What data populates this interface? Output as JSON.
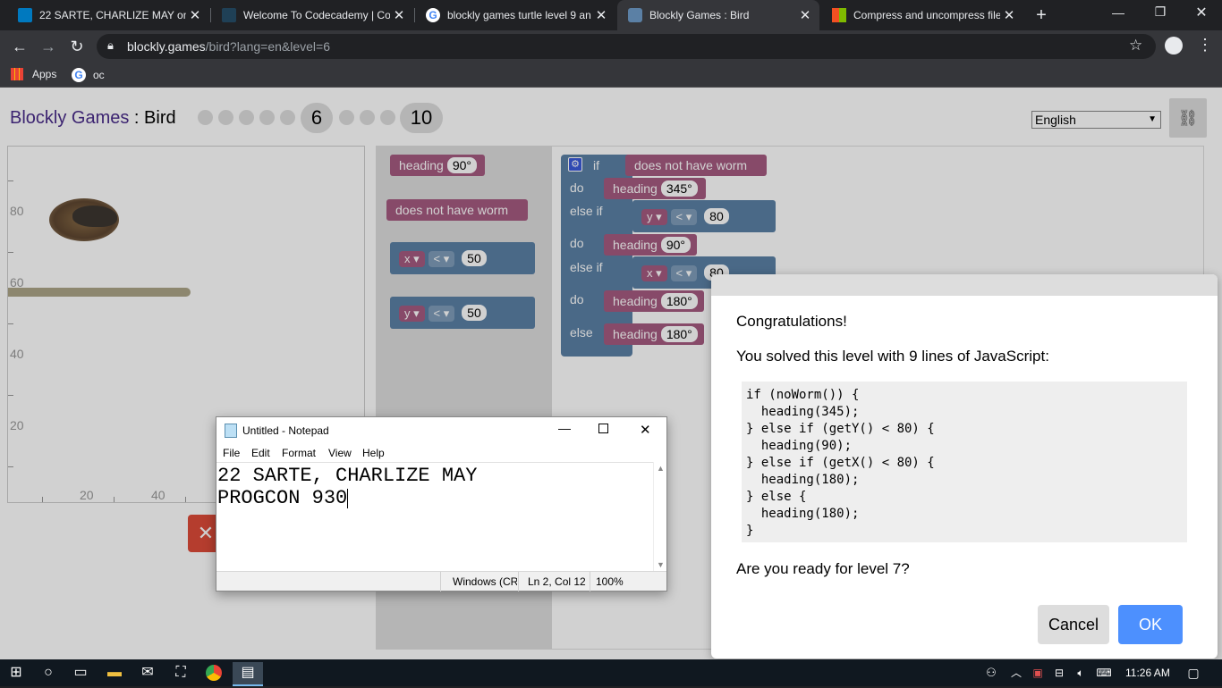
{
  "browser": {
    "tabs": [
      {
        "label": "22 SARTE, CHARLIZE MAY on 2",
        "icon": "trello-icon",
        "active": false
      },
      {
        "label": "Welcome To Codecademy | Co",
        "icon": "codecademy-icon",
        "active": false
      },
      {
        "label": "blockly games turtle level 9 an",
        "icon": "google-icon",
        "active": false
      },
      {
        "label": "Blockly Games : Bird",
        "icon": "blockly-icon",
        "active": true
      },
      {
        "label": "Compress and uncompress file",
        "icon": "microsoft-icon",
        "active": false
      }
    ],
    "new_tab": "+",
    "url_host": "blockly.games",
    "url_path": "/bird?lang=en&level=6",
    "bookmarks": [
      {
        "label": "Apps",
        "icon": "apps-grid-icon"
      },
      {
        "label": "oc",
        "icon": "google-icon"
      }
    ]
  },
  "page": {
    "title_app": "Blockly Games",
    "title_sep": " : ",
    "title_game": "Bird",
    "levels": [
      "1",
      "2",
      "3",
      "4",
      "5",
      "6",
      "7",
      "8",
      "9",
      "10"
    ],
    "current_level": "6",
    "last_level": "10",
    "language": "English",
    "link_icon": "link-icon",
    "axis_labels": {
      "y80": "80",
      "y60": "60",
      "y40": "40",
      "y20": "20",
      "x20": "20",
      "x40": "40"
    },
    "reset_label": "✕"
  },
  "toolbox": {
    "heading_label": "heading",
    "heading_value": "90°",
    "no_worm": "does not have worm",
    "compare_x": {
      "var": "x",
      "op": "<",
      "value": "50"
    },
    "compare_y": {
      "var": "y",
      "op": "<",
      "value": "50"
    }
  },
  "workspace": {
    "if": "if",
    "do": "do",
    "else_if": "else if",
    "else": "else",
    "heading": "heading",
    "cond1": "does not have worm",
    "h1": "345°",
    "cond2_var": "y",
    "cond2_op": "<",
    "cond2_val": "80",
    "h2": "90°",
    "cond3_var": "x",
    "cond3_op": "<",
    "cond3_val": "80",
    "h3": "180°",
    "h4": "180°"
  },
  "dialog": {
    "title": "Congratulations!",
    "message": "You solved this level with 9 lines of JavaScript:",
    "code": [
      "if (noWorm()) {",
      "  heading(345);",
      "} else if (getY() < 80) {",
      "  heading(90);",
      "} else if (getX() < 80) {",
      "  heading(180);",
      "} else {",
      "  heading(180);",
      "}"
    ],
    "question": "Are you ready for level 7?",
    "cancel": "Cancel",
    "ok": "OK"
  },
  "notepad": {
    "title": "Untitled - Notepad",
    "menu": [
      "File",
      "Edit",
      "Format",
      "View",
      "Help"
    ],
    "line1": "22 SARTE, CHARLIZE MAY",
    "line2": "PROGCON 930",
    "status_encoding": "Windows (CR",
    "status_pos": "Ln 2, Col 12",
    "status_zoom": "100%"
  },
  "taskbar": {
    "time": "11:26 AM"
  },
  "colors": {
    "title_purple": "#4a2c8a",
    "ok_blue": "#4d90fe",
    "block_pink": "#a55b80",
    "block_blue": "#5b80a5",
    "reset_red": "#dd4b39"
  }
}
